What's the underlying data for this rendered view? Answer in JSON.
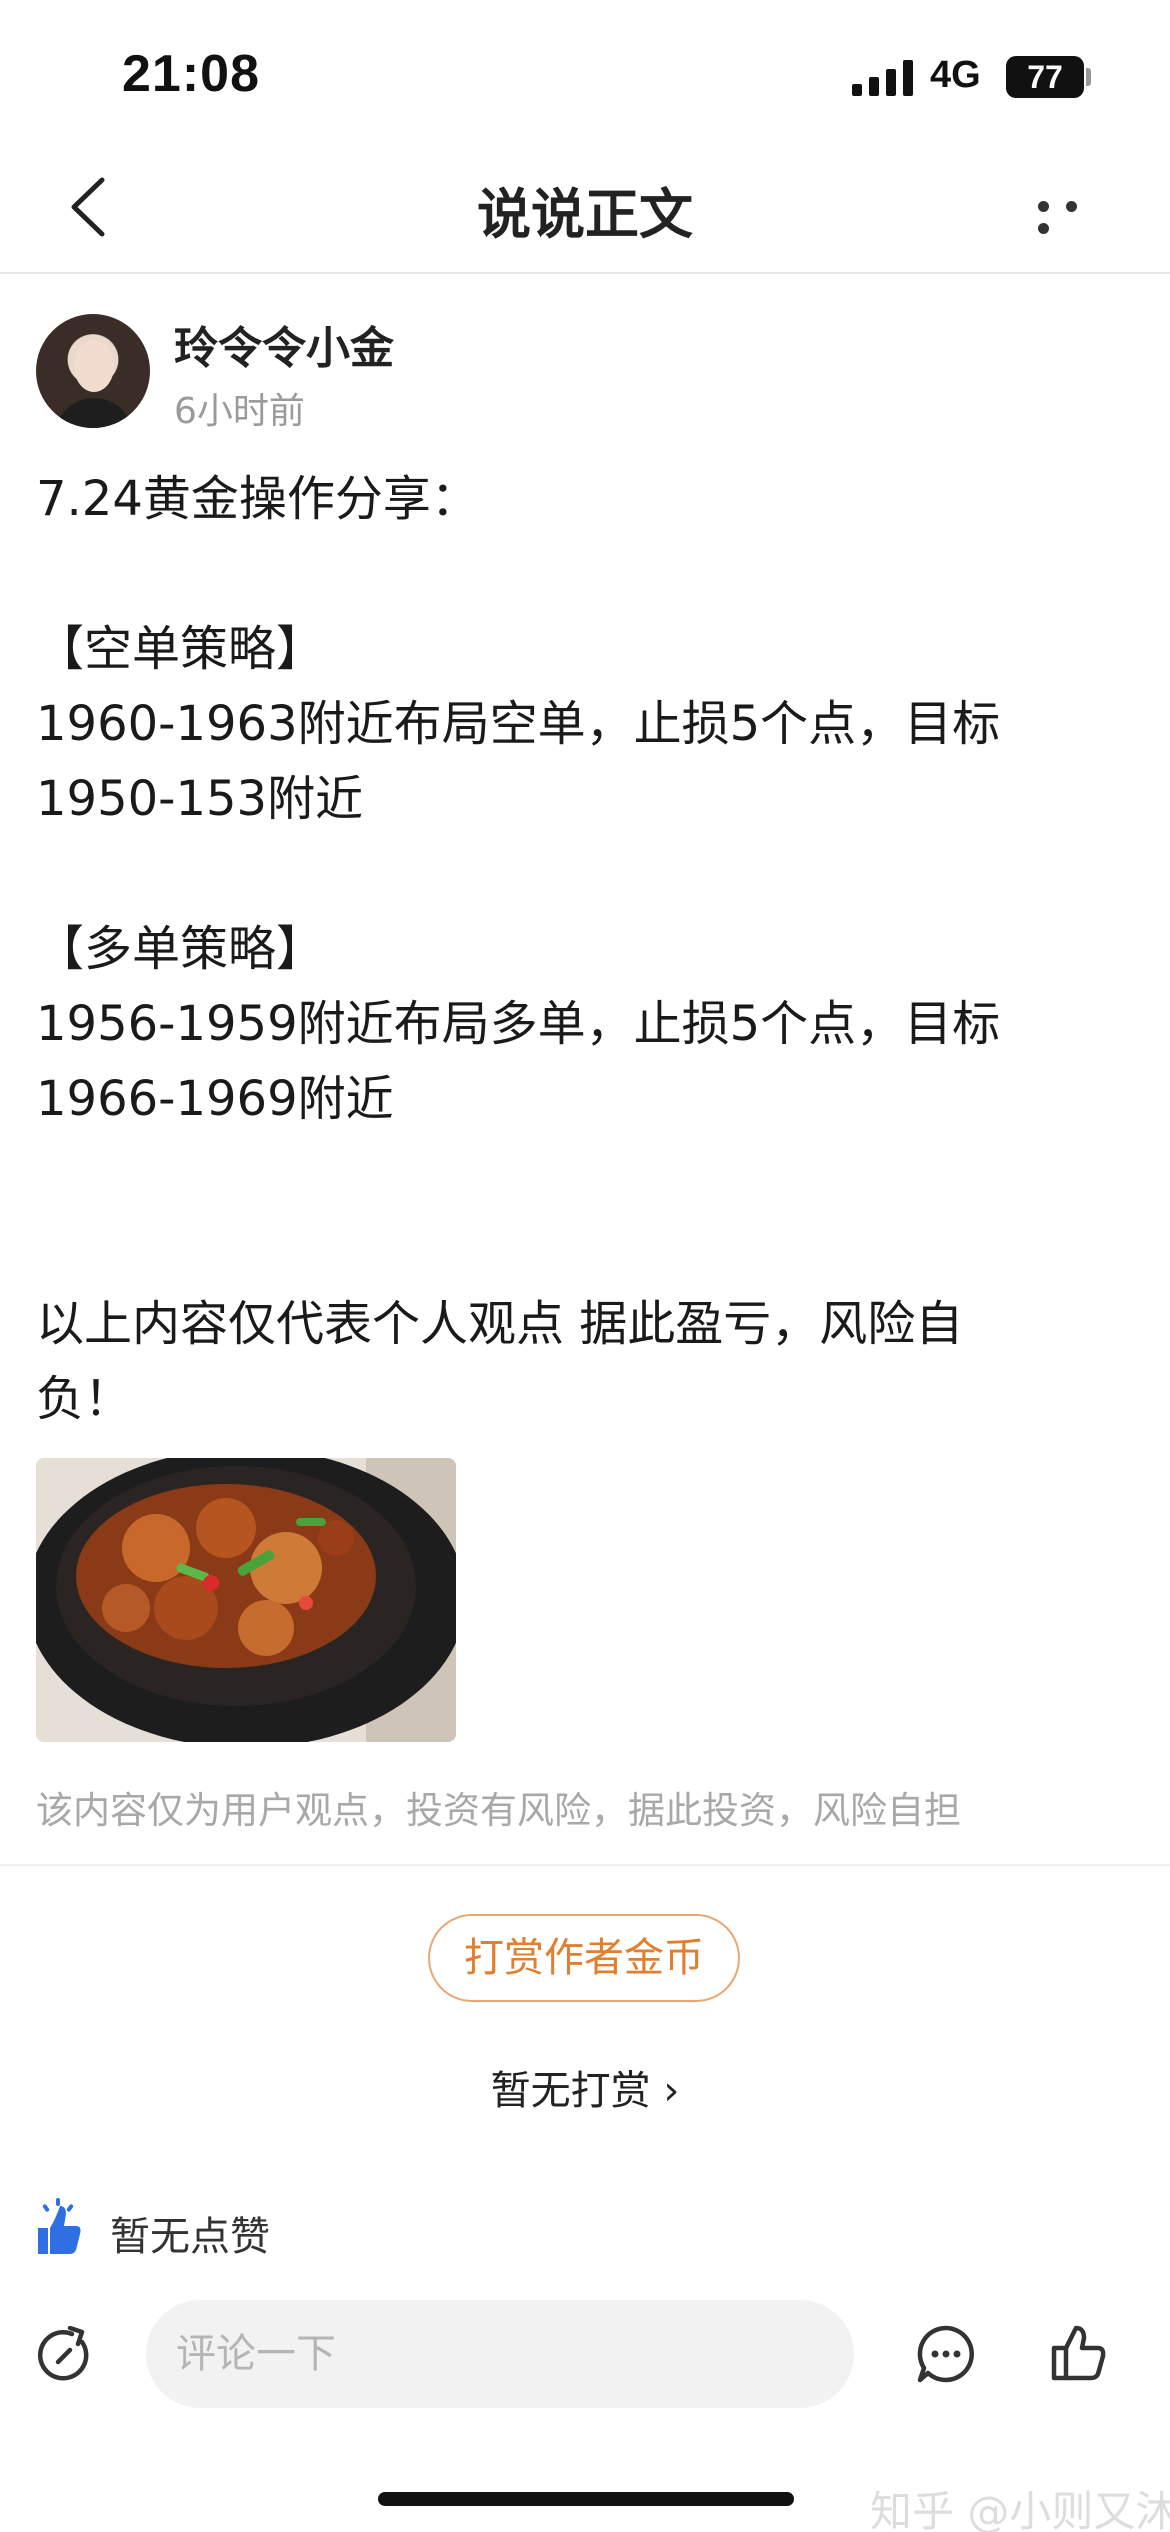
{
  "status_bar": {
    "time": "21:08",
    "network": "4G",
    "battery": "77"
  },
  "nav": {
    "title": "说说正文"
  },
  "author": {
    "name": "玲令令小金",
    "time": "6小时前"
  },
  "post": {
    "lines": [
      "7.24黄金操作分享：",
      "【空单策略】",
      "1960-1963附近布局空单，止损5个点，目标",
      "1950-153附近",
      "【多单策略】",
      "1956-1959附近布局多单，止损5个点，目标",
      "1966-1969附近",
      "以上内容仅代表个人观点 据此盈亏，风险自",
      "负！"
    ]
  },
  "disclaimer": "该内容仅为用户观点，投资有风险，据此投资，风险自担",
  "reward": {
    "button_label": "打赏作者金币",
    "status": "暂无打赏 ›"
  },
  "likes": {
    "status": "暂无点赞"
  },
  "comment": {
    "placeholder": "评论一下"
  },
  "watermark": "知乎 @小则又沐风",
  "colors": {
    "accent_orange": "#e07f2e",
    "like_blue": "#2f6fe4"
  },
  "icons": [
    "back-arrow",
    "more-dots",
    "signal",
    "battery",
    "like-hand",
    "share",
    "message",
    "thumb-up"
  ]
}
